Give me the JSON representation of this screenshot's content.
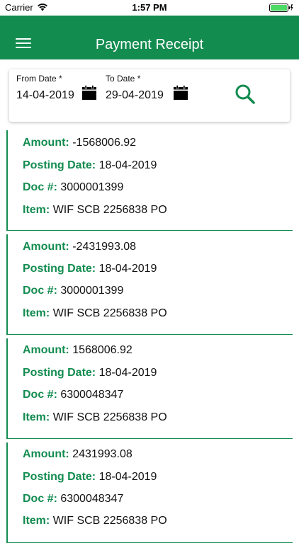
{
  "status_bar": {
    "carrier": "Carrier",
    "time": "1:57 PM"
  },
  "header": {
    "title": "Payment Receipt"
  },
  "filter": {
    "from_label": "From Date *",
    "from_value": "14-04-2019",
    "to_label": "To Date *",
    "to_value": "29-04-2019"
  },
  "receipt_labels": {
    "amount": "Amount:",
    "posting_date": "Posting Date:",
    "doc": "Doc #:",
    "item": "Item:"
  },
  "receipts": [
    {
      "amount": "-1568006.92",
      "posting_date": "18-04-2019",
      "doc": "3000001399",
      "item": "WIF SCB 2256838 PO"
    },
    {
      "amount": "-2431993.08",
      "posting_date": "18-04-2019",
      "doc": "3000001399",
      "item": "WIF SCB 2256838 PO"
    },
    {
      "amount": "1568006.92",
      "posting_date": "18-04-2019",
      "doc": "6300048347",
      "item": "WIF SCB 2256838 PO"
    },
    {
      "amount": "2431993.08",
      "posting_date": "18-04-2019",
      "doc": "6300048347",
      "item": "WIF SCB 2256838 PO"
    }
  ],
  "colors": {
    "brand_green": "#138c50",
    "header_text": "#ffffff",
    "battery_green": "#4cd964"
  },
  "icons": {
    "menu": "hamburger-menu-icon",
    "calendar": "calendar-icon",
    "search": "search-icon",
    "wifi": "wifi-icon",
    "battery": "battery-icon"
  }
}
